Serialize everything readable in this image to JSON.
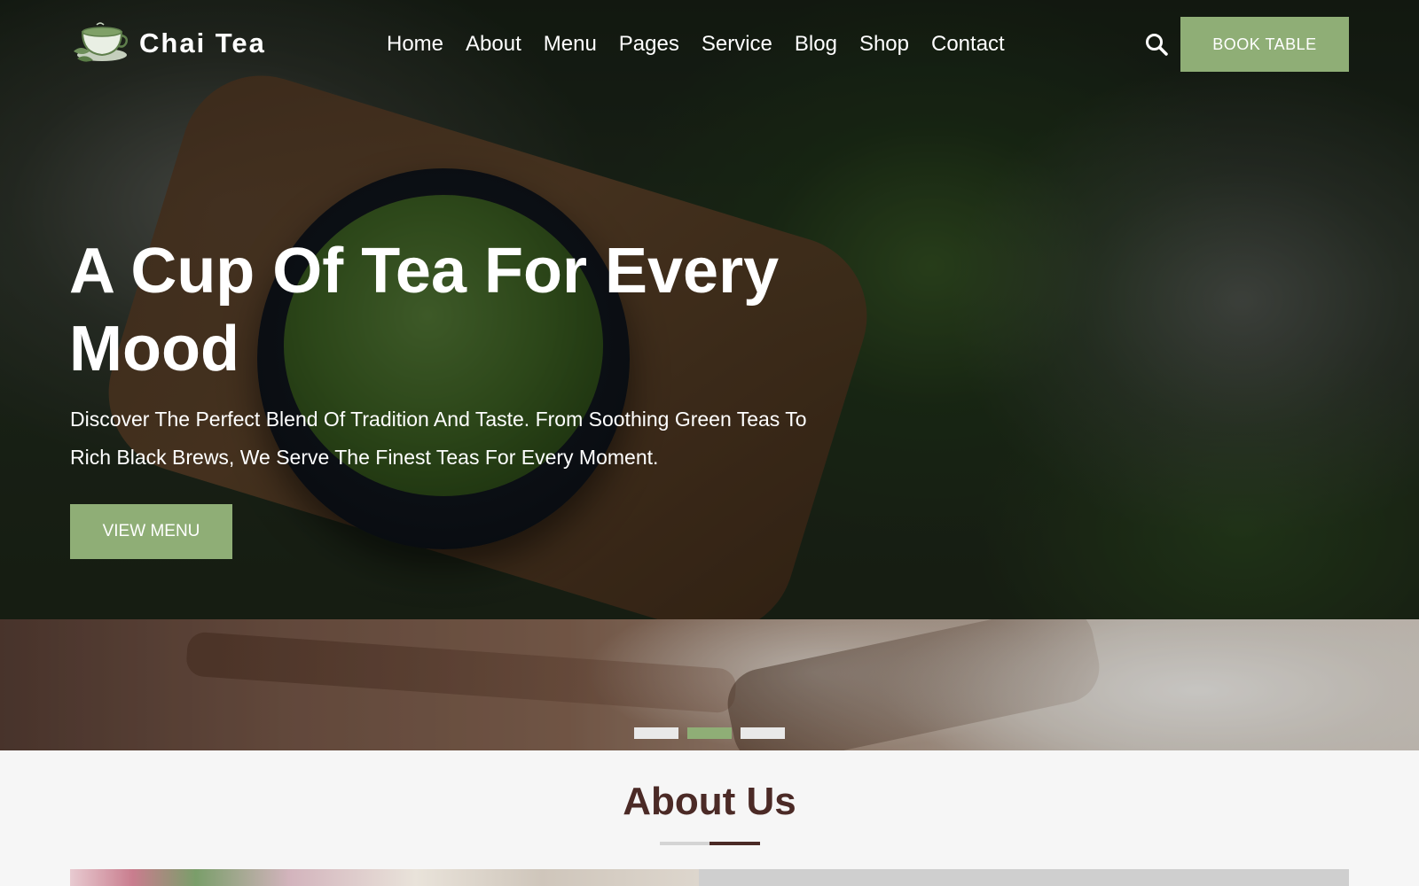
{
  "brand": {
    "name": "Chai Tea",
    "logo_icon": "teacup-logo-icon"
  },
  "nav": {
    "items": [
      {
        "label": "Home"
      },
      {
        "label": "About"
      },
      {
        "label": "Menu"
      },
      {
        "label": "Pages"
      },
      {
        "label": "Service"
      },
      {
        "label": "Blog"
      },
      {
        "label": "Shop"
      },
      {
        "label": "Contact"
      }
    ],
    "search_icon": "search-icon",
    "book_label": "BOOK TABLE"
  },
  "hero": {
    "title": "A Cup Of Tea For Every Mood",
    "subtitle": "Discover The Perfect Blend Of Tradition And Taste. From Soothing Green Teas To Rich Black Brews, We Serve The Finest Teas For Every Moment.",
    "cta_label": "VIEW MENU"
  },
  "carousel": {
    "slide_count": 3,
    "active_index": 1
  },
  "about": {
    "title": "About Us"
  },
  "colors": {
    "accent": "#8fae76",
    "heading": "#4b2a26",
    "page_bg": "#f6f6f6"
  }
}
